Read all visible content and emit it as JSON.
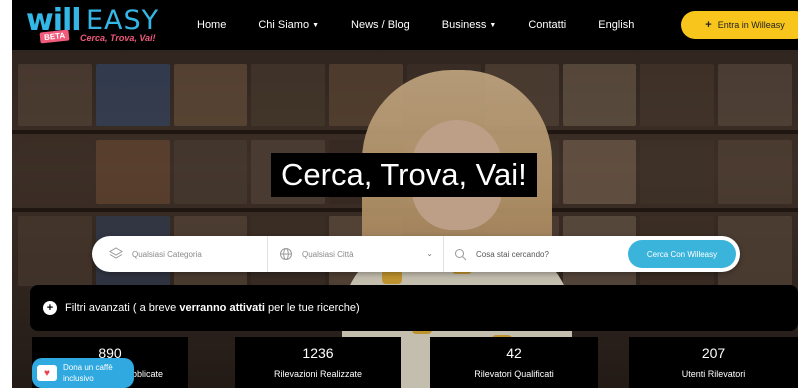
{
  "header": {
    "logo_primary": "will",
    "logo_secondary": "EASY",
    "logo_badge": "BETA",
    "logo_tagline": "Cerca, Trova, Vai!",
    "nav": [
      {
        "label": "Home",
        "has_dropdown": false
      },
      {
        "label": "Chi Siamo",
        "has_dropdown": true
      },
      {
        "label": "News / Blog",
        "has_dropdown": false
      },
      {
        "label": "Business",
        "has_dropdown": true
      },
      {
        "label": "Contatti",
        "has_dropdown": false
      },
      {
        "label": "English",
        "has_dropdown": false
      }
    ],
    "cta_label": "Entra in Willeasy"
  },
  "hero": {
    "title": "Cerca, Trova, Vai!"
  },
  "search": {
    "category_placeholder": "Qualsiasi Categoria",
    "city_placeholder": "Qualsiasi Città",
    "query_placeholder": "Cosa stai cercando?",
    "button_label": "Cerca Con Willeasy"
  },
  "filters": {
    "text_before": "Filtri avanzati ( a breve ",
    "text_bold": "verranno attivati",
    "text_after": " per le tue ricerche)"
  },
  "stats": [
    {
      "value": "890",
      "label": "Pubblicate"
    },
    {
      "value": "1236",
      "label": "Rilevazioni Realizzate"
    },
    {
      "value": "42",
      "label": "Rilevatori Qualificati"
    },
    {
      "value": "207",
      "label": "Utenti Rilevatori"
    }
  ],
  "donate": {
    "label_line1": "Dona un caffè",
    "label_line2": "inclusivo"
  },
  "colors": {
    "brand_blue": "#34b7e6",
    "brand_pink": "#f15a7a",
    "cta_yellow": "#f7c51b",
    "search_button": "#3bb4dc",
    "donate_blue": "#2fa9e0",
    "bar_black": "#000000"
  },
  "icons": {
    "category": "layers-icon",
    "city": "globe-icon",
    "search": "search-icon",
    "cup": "coffee-cup-icon",
    "plus": "plus-icon"
  }
}
